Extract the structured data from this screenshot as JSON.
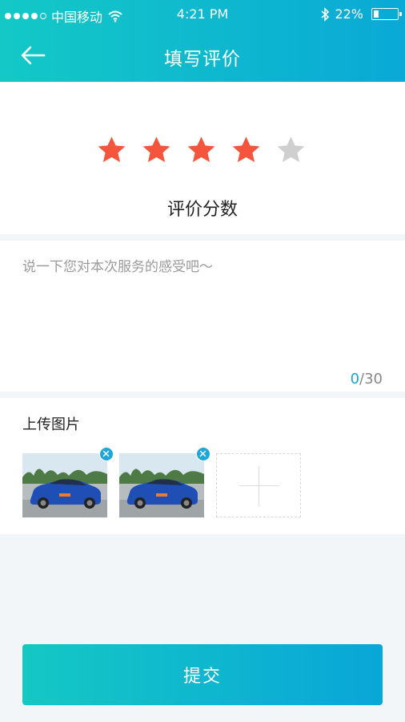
{
  "status_bar": {
    "carrier": "中国移动",
    "time": "4:21 PM",
    "battery": "22%",
    "battery_level": 0.22,
    "signal_bars_filled": 4,
    "signal_bars_total": 5,
    "icons": [
      "signal-dots-icon",
      "wifi-icon",
      "bluetooth-icon",
      "battery-icon"
    ]
  },
  "nav": {
    "title": "填写评价",
    "back_icon": "arrow-left-icon"
  },
  "rating": {
    "value": 4,
    "max": 5,
    "label": "评价分数",
    "active_color": "#f5553c",
    "inactive_color": "#cfcfcf"
  },
  "comment": {
    "placeholder": "说一下您对本次服务的感受吧～",
    "value": "",
    "count": "0",
    "max": "/30"
  },
  "upload": {
    "title": "上传图片",
    "photos": [
      {
        "label": "blue car photo"
      },
      {
        "label": "blue car photo"
      }
    ],
    "add_icon": "plus-icon",
    "remove_icon": "close-icon"
  },
  "submit": {
    "label": "提交"
  },
  "colors": {
    "brand_gradient_start": "#13c9c6",
    "brand_gradient_end": "#0aa9d6",
    "background": "#f2f6f9",
    "counter_accent": "#1aa6d6"
  }
}
